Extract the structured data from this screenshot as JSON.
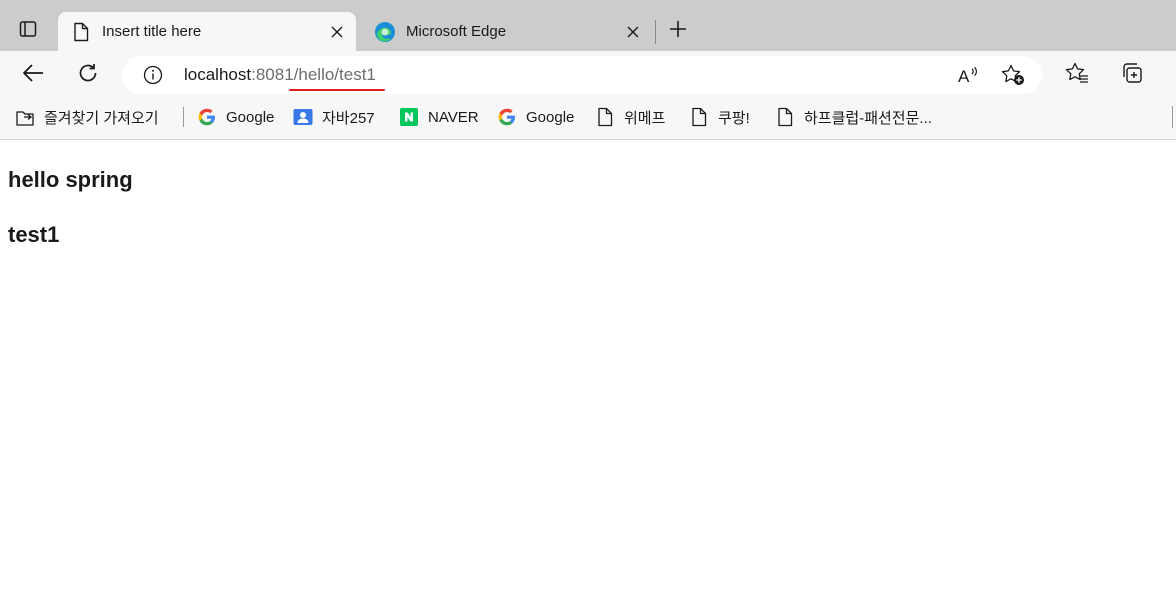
{
  "tabs": [
    {
      "label": "Insert title here",
      "icon": "page-icon",
      "active": true
    },
    {
      "label": "Microsoft Edge",
      "icon": "edge-logo-icon",
      "active": false
    }
  ],
  "address": {
    "host": "localhost",
    "port": ":8081",
    "path": "/hello/test1"
  },
  "bookmarks": [
    {
      "label": "즐겨찾기 가져오기",
      "icon": "import-favorites-icon"
    },
    {
      "label": "Google",
      "icon": "google-icon"
    },
    {
      "label": "자바257",
      "icon": "contact-card-icon"
    },
    {
      "label": "NAVER",
      "icon": "naver-icon"
    },
    {
      "label": "Google",
      "icon": "google-icon"
    },
    {
      "label": "위메프",
      "icon": "page-icon"
    },
    {
      "label": "쿠팡!",
      "icon": "page-icon"
    },
    {
      "label": "하프클럽-패션전문...",
      "icon": "page-icon"
    }
  ],
  "page": {
    "heading1": "hello spring",
    "heading2": "test1"
  },
  "colors": {
    "tabstrip": "#cccccc",
    "toolbar": "#f7f7f7",
    "annotation_underline": "#e02020",
    "naver_green": "#03c75a"
  }
}
